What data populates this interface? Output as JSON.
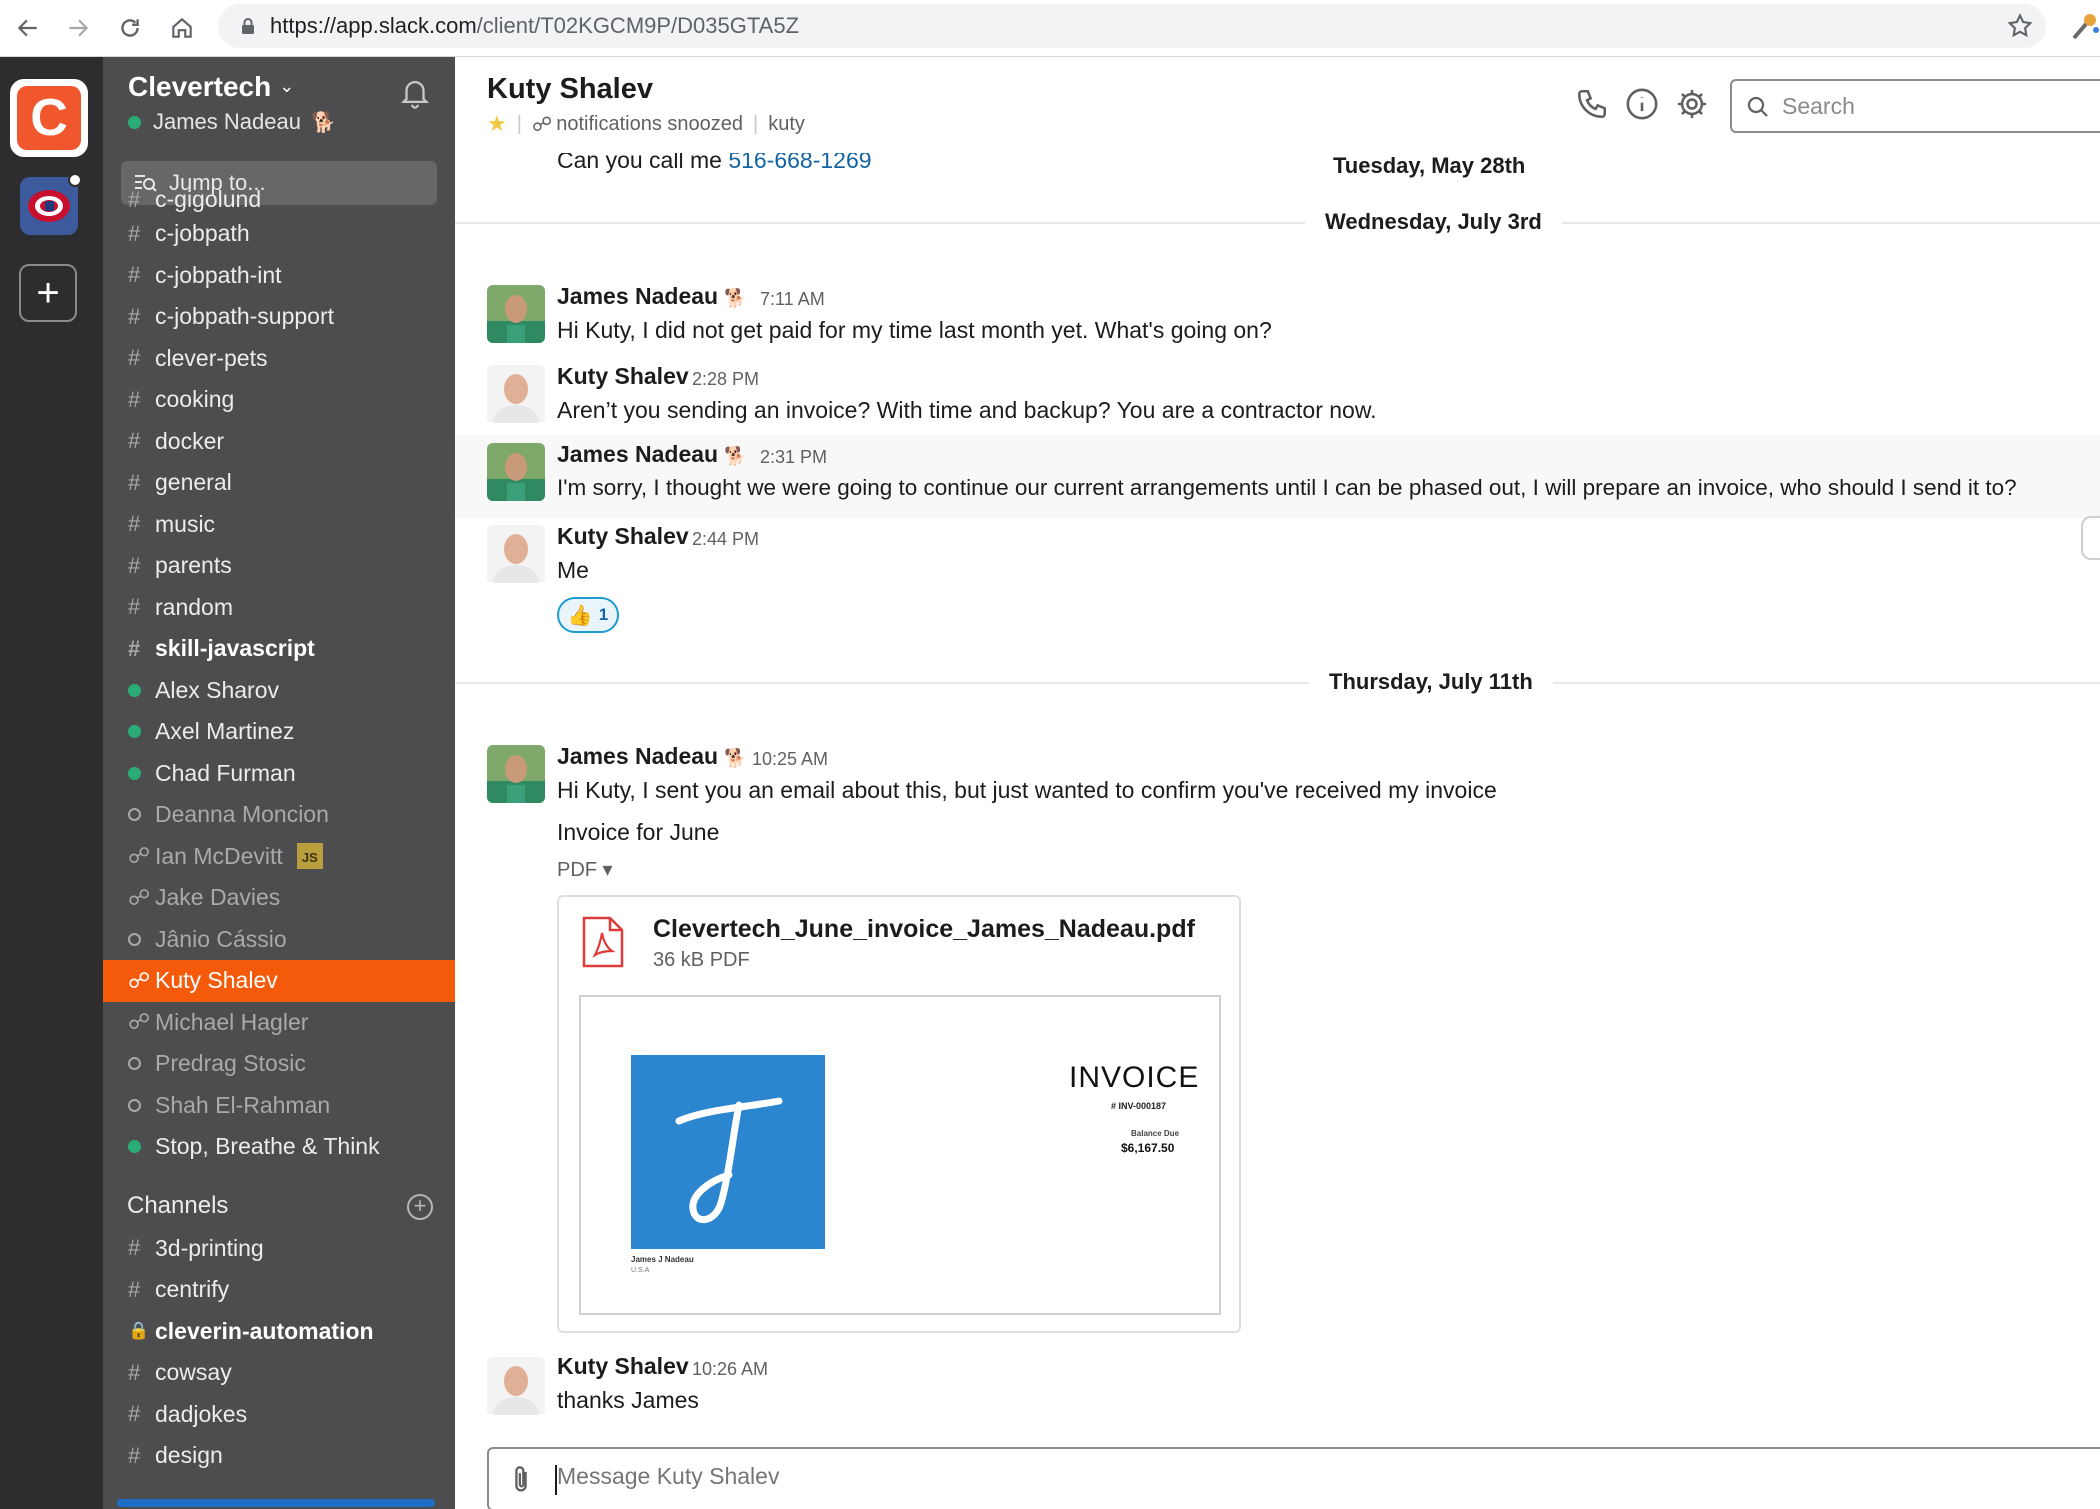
{
  "browser": {
    "url_host": "https://app.slack.com",
    "url_path": "/client/T02KGCM9P/D035GTA5Z"
  },
  "team": {
    "name": "Clevertech",
    "user": "James Nadeau",
    "user_emoji": "🐕",
    "jump_placeholder": "Jump to..."
  },
  "sidebar": {
    "cut_item": "c-gigolund",
    "items": [
      {
        "prefix": "#",
        "label": "c-jobpath",
        "style": "normal"
      },
      {
        "prefix": "#",
        "label": "c-jobpath-int",
        "style": "normal"
      },
      {
        "prefix": "#",
        "label": "c-jobpath-support",
        "style": "normal"
      },
      {
        "prefix": "#",
        "label": "clever-pets",
        "style": "normal"
      },
      {
        "prefix": "#",
        "label": "cooking",
        "style": "normal"
      },
      {
        "prefix": "#",
        "label": "docker",
        "style": "normal"
      },
      {
        "prefix": "#",
        "label": "general",
        "style": "normal"
      },
      {
        "prefix": "#",
        "label": "music",
        "style": "normal"
      },
      {
        "prefix": "#",
        "label": "parents",
        "style": "normal"
      },
      {
        "prefix": "#",
        "label": "random",
        "style": "normal"
      },
      {
        "prefix": "#",
        "label": "skill-javascript",
        "style": "bold"
      },
      {
        "prefix": "online",
        "label": "Alex Sharov",
        "style": "normal"
      },
      {
        "prefix": "online",
        "label": "Axel Martinez",
        "style": "normal"
      },
      {
        "prefix": "online",
        "label": "Chad Furman",
        "style": "normal"
      },
      {
        "prefix": "away",
        "label": "Deanna Moncion",
        "style": "muted"
      },
      {
        "prefix": "ext",
        "label": "Ian McDevitt",
        "style": "muted",
        "badge": "JS"
      },
      {
        "prefix": "ext",
        "label": "Jake Davies",
        "style": "muted"
      },
      {
        "prefix": "away",
        "label": "Jânio Cássio",
        "style": "muted"
      },
      {
        "prefix": "ext",
        "label": "Kuty Shalev",
        "style": "active"
      },
      {
        "prefix": "ext",
        "label": "Michael Hagler",
        "style": "muted"
      },
      {
        "prefix": "away",
        "label": "Predrag Stosic",
        "style": "muted"
      },
      {
        "prefix": "away",
        "label": "Shah El-Rahman",
        "style": "muted"
      },
      {
        "prefix": "online",
        "label": "Stop, Breathe & Think",
        "style": "normal"
      }
    ],
    "channels_header": "Channels",
    "channels": [
      {
        "prefix": "#",
        "label": "3d-printing",
        "style": "normal"
      },
      {
        "prefix": "#",
        "label": "centrify",
        "style": "normal"
      },
      {
        "prefix": "lock",
        "label": "cleverin-automation",
        "style": "bold"
      },
      {
        "prefix": "#",
        "label": "cowsay",
        "style": "normal"
      },
      {
        "prefix": "#",
        "label": "dadjokes",
        "style": "normal"
      },
      {
        "prefix": "#",
        "label": "design",
        "style": "normal"
      }
    ]
  },
  "channel": {
    "name": "Kuty Shalev",
    "status": "notifications snoozed",
    "handle": "kuty",
    "search_placeholder": "Search"
  },
  "messages": {
    "top_text": "Can you call me ",
    "top_phone": "516-668-1269",
    "day1": "Tuesday, May 28th",
    "day2": "Wednesday, July 3rd",
    "day3": "Thursday, July 11th",
    "m1": {
      "name": "James Nadeau",
      "time": "7:11 AM",
      "text": "Hi Kuty, I did not get paid for my time last month yet. What's going on?"
    },
    "m2": {
      "name": "Kuty Shalev",
      "time": "2:28 PM",
      "text": "Aren’t you sending an invoice? With time and backup? You are a contractor now."
    },
    "m3": {
      "name": "James Nadeau",
      "time": "2:31 PM",
      "text": "I'm sorry, I thought we were going to continue our current arrangements until I can be phased out, I will prepare an invoice, who should I send it to?"
    },
    "m4": {
      "name": "Kuty Shalev",
      "time": "2:44 PM",
      "text": "Me",
      "reaction_count": "1"
    },
    "m5": {
      "name": "James Nadeau",
      "time": "10:25 AM",
      "text": "Hi Kuty, I sent you an email about this, but just wanted to confirm you've received my invoice",
      "file_title": "Invoice for June",
      "file_type": "PDF ▾"
    },
    "m6": {
      "name": "Kuty Shalev",
      "time": "10:26 AM",
      "text": "thanks James"
    }
  },
  "file": {
    "name": "Clevertech_June_invoice_James_Nadeau.pdf",
    "size": "36 kB PDF",
    "invoice_title": "INVOICE",
    "invoice_no": "# INV-000187",
    "balance_label": "Balance Due",
    "balance": "$6,167.50",
    "sig_name": "James J Nadeau",
    "sig_loc": "U.S.A"
  },
  "composer": {
    "placeholder": "Message Kuty Shalev"
  },
  "colors": {
    "active_item": "#f55a0a",
    "sidebar_bg": "#4d4d50",
    "rail_bg": "#2d2d30",
    "online": "#2bac76",
    "link": "#1264a3"
  }
}
